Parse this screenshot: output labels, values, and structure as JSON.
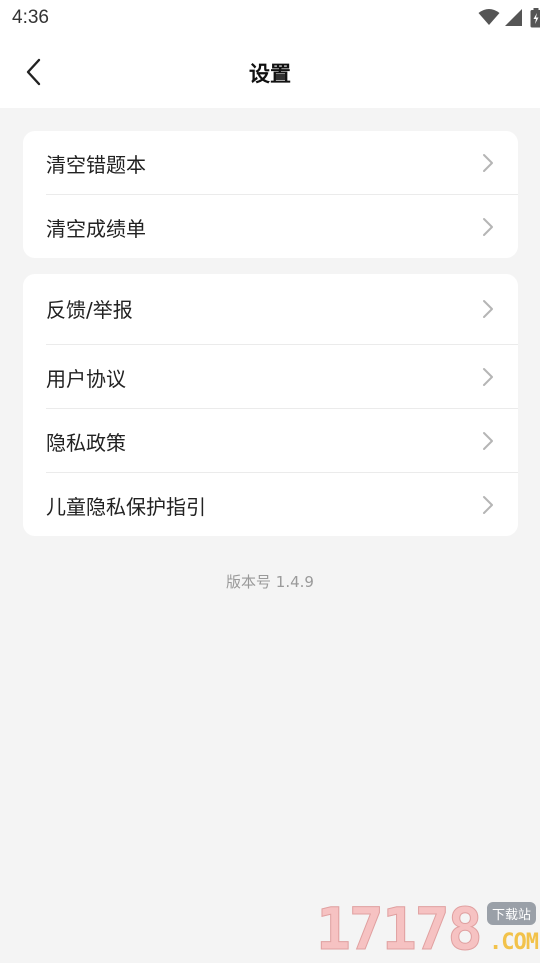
{
  "status_bar": {
    "time": "4:36",
    "icons": [
      "wifi-icon",
      "cell-signal-icon",
      "battery-charging-icon"
    ]
  },
  "nav": {
    "title": "设置",
    "back_icon": "chevron-left-icon"
  },
  "groups": [
    {
      "items": [
        {
          "label": "清空错题本"
        },
        {
          "label": "清空成绩单"
        }
      ]
    },
    {
      "items": [
        {
          "label": "反馈/举报"
        },
        {
          "label": "用户协议"
        },
        {
          "label": "隐私政策"
        },
        {
          "label": "儿童隐私保护指引"
        }
      ]
    }
  ],
  "version_text": "版本号 1.4.9",
  "watermark": {
    "digits": "17178",
    "badge": "下载站",
    "domain": ".COM"
  },
  "colors": {
    "page_background": "#f4f4f4",
    "card_background": "#ffffff",
    "secondary_text": "#9a9a9a",
    "chevron": "#b5b5b5"
  }
}
